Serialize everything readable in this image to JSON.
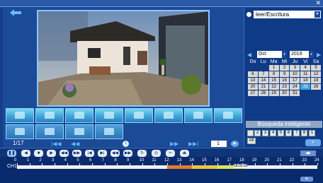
{
  "window": {
    "close_label": "✕"
  },
  "pagination": {
    "current": "1/17",
    "page_input": "1"
  },
  "mode": {
    "selected": "leer/Escritura"
  },
  "calendar": {
    "month": "Oct",
    "year": "2019",
    "dow": [
      "Do",
      "Lu",
      "Ma",
      "Mi",
      "Ju",
      "Vi",
      "Sa"
    ],
    "weeks": [
      [
        "",
        "",
        "1",
        "2",
        "3",
        "4",
        "5"
      ],
      [
        "6",
        "7",
        "8",
        "9",
        "10",
        "11",
        "12"
      ],
      [
        "13",
        "14",
        "15",
        "16",
        "17",
        "18",
        "19"
      ],
      [
        "20",
        "21",
        "22",
        "23",
        "24",
        "25",
        "26"
      ],
      [
        "27",
        "28",
        "29",
        "30",
        "31",
        "",
        ""
      ]
    ],
    "selected_day": "25"
  },
  "smart_search": {
    "label": "Búsqueda inteligente"
  },
  "channels": [
    "1",
    "2",
    "3",
    "4",
    "5",
    "6",
    "7",
    "8"
  ],
  "channel_all": "All",
  "timeline": {
    "channel_label": "CH1",
    "hours": [
      "0",
      "1",
      "2",
      "3",
      "4",
      "5",
      "6",
      "7",
      "8",
      "9",
      "10",
      "11",
      "12",
      "13",
      "14",
      "15",
      "16",
      "17",
      "18",
      "19",
      "20",
      "21",
      "22",
      "23",
      "24"
    ],
    "readout": "18:00:26",
    "segments": [
      {
        "start_hour": 12.0,
        "end_hour": 14.0,
        "color": "#e87a2a"
      },
      {
        "start_hour": 14.0,
        "end_hour": 16.0,
        "color": "#e8c83a"
      },
      {
        "start_hour": 16.0,
        "end_hour": 18.2,
        "color": "#d8e85a"
      }
    ]
  },
  "colors": {
    "accent": "#3da6d8",
    "panel": "#0f3a86",
    "bg": "#163f8a"
  }
}
